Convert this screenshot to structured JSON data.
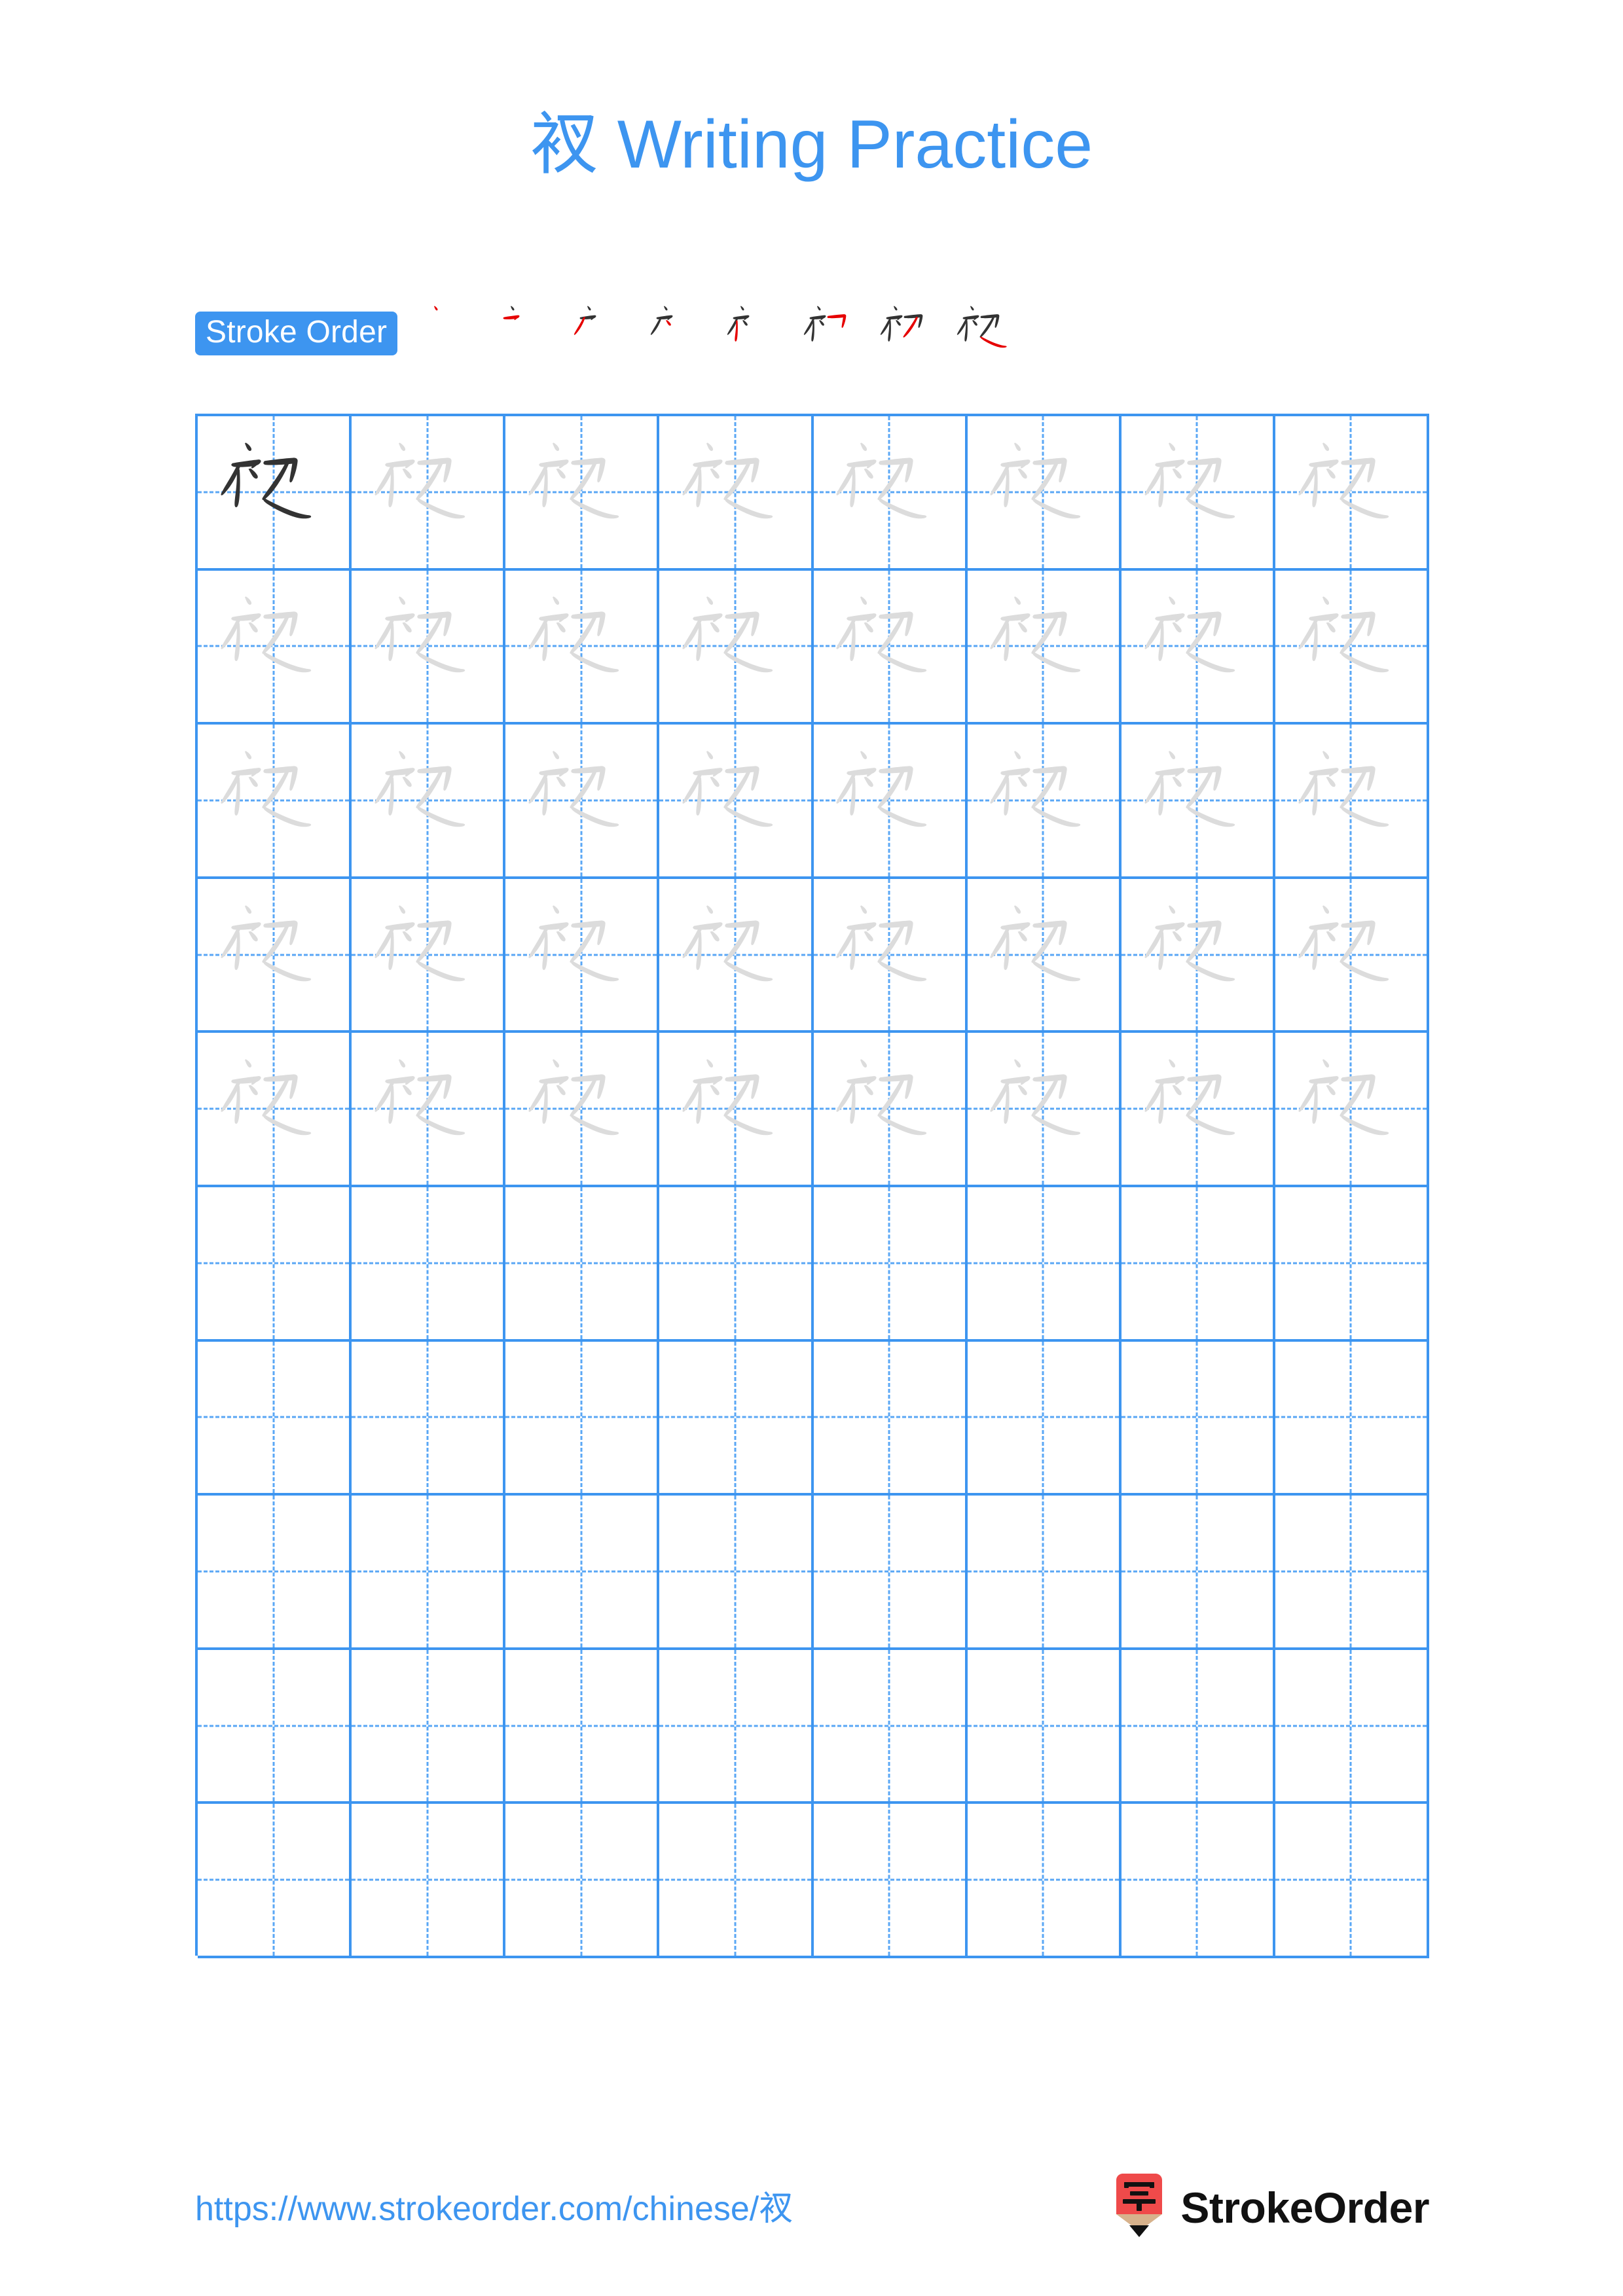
{
  "page": {
    "character": "衩",
    "title": "衩 Writing Practice",
    "background_color": "#ffffff",
    "accent_color": "#3d95f0",
    "grid_line_color": "#3d95f0",
    "guide_line_color": "#5aa7f5",
    "trace_color": "#dcdcdc",
    "ink_color": "#333333",
    "new_stroke_color": "#e60000"
  },
  "stroke_order": {
    "badge_label": "Stroke Order",
    "total_strokes": 8,
    "steps": [
      {
        "index": 1,
        "strokes_shown": 1,
        "new_stroke": 1
      },
      {
        "index": 2,
        "strokes_shown": 2,
        "new_stroke": 2
      },
      {
        "index": 3,
        "strokes_shown": 3,
        "new_stroke": 3
      },
      {
        "index": 4,
        "strokes_shown": 4,
        "new_stroke": 4
      },
      {
        "index": 5,
        "strokes_shown": 5,
        "new_stroke": 5
      },
      {
        "index": 6,
        "strokes_shown": 6,
        "new_stroke": 6
      },
      {
        "index": 7,
        "strokes_shown": 7,
        "new_stroke": 7
      },
      {
        "index": 8,
        "strokes_shown": 8,
        "new_stroke": 8
      }
    ]
  },
  "practice_grid": {
    "columns": 8,
    "rows": 10,
    "cells_with_dark_character": 1,
    "cells_with_trace_character": 39,
    "empty_cells": 40,
    "row_fill": [
      [
        "dark",
        "trace",
        "trace",
        "trace",
        "trace",
        "trace",
        "trace",
        "trace"
      ],
      [
        "trace",
        "trace",
        "trace",
        "trace",
        "trace",
        "trace",
        "trace",
        "trace"
      ],
      [
        "trace",
        "trace",
        "trace",
        "trace",
        "trace",
        "trace",
        "trace",
        "trace"
      ],
      [
        "trace",
        "trace",
        "trace",
        "trace",
        "trace",
        "trace",
        "trace",
        "trace"
      ],
      [
        "trace",
        "trace",
        "trace",
        "trace",
        "trace",
        "trace",
        "trace",
        "trace"
      ],
      [
        "empty",
        "empty",
        "empty",
        "empty",
        "empty",
        "empty",
        "empty",
        "empty"
      ],
      [
        "empty",
        "empty",
        "empty",
        "empty",
        "empty",
        "empty",
        "empty",
        "empty"
      ],
      [
        "empty",
        "empty",
        "empty",
        "empty",
        "empty",
        "empty",
        "empty",
        "empty"
      ],
      [
        "empty",
        "empty",
        "empty",
        "empty",
        "empty",
        "empty",
        "empty",
        "empty"
      ],
      [
        "empty",
        "empty",
        "empty",
        "empty",
        "empty",
        "empty",
        "empty",
        "empty"
      ]
    ]
  },
  "footer": {
    "url": "https://www.strokeorder.com/chinese/衩",
    "brand_name": "StrokeOrder",
    "logo_character": "字",
    "logo_body_color": "#ef4a4a",
    "logo_wood_color": "#d7b28c",
    "logo_tip_color": "#111111"
  }
}
